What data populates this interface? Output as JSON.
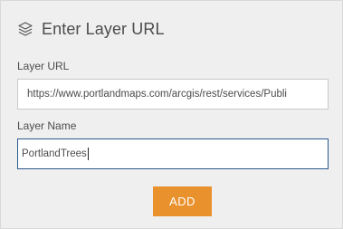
{
  "header": {
    "icon": "layers-icon",
    "title": "Enter Layer URL"
  },
  "form": {
    "url_label": "Layer URL",
    "url_value": "https://www.portlandmaps.com/arcgis/rest/services/Publi",
    "name_label": "Layer Name",
    "name_value": "PortlandTrees",
    "add_label": "ADD"
  },
  "colors": {
    "button": "#e8912d",
    "focused_border": "#2a5a8f",
    "background": "#efefef"
  }
}
